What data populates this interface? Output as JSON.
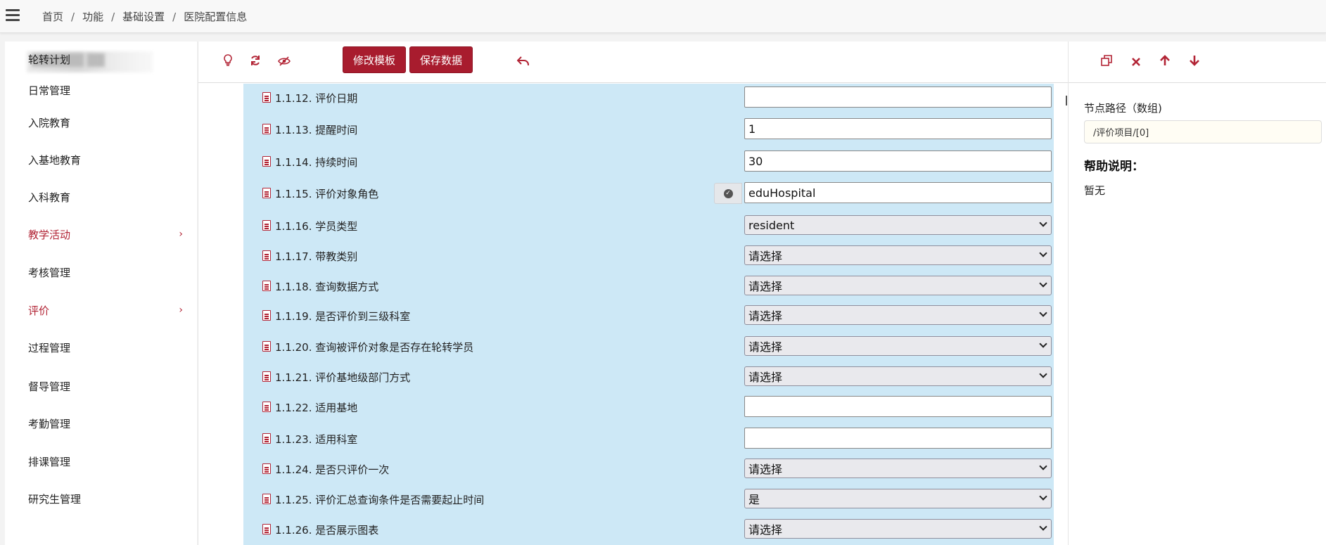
{
  "breadcrumb": [
    "首页",
    "功能",
    "基础设置",
    "医院配置信息"
  ],
  "sidebar": {
    "logo_text": "██████ ██",
    "items": [
      {
        "label": "轮转计划",
        "active": false,
        "has_sub": false
      },
      {
        "label": "日常管理",
        "active": false,
        "has_sub": false
      },
      {
        "label": "入院教育",
        "active": false,
        "has_sub": false
      },
      {
        "label": "入基地教育",
        "active": false,
        "has_sub": false
      },
      {
        "label": "入科教育",
        "active": false,
        "has_sub": false
      },
      {
        "label": "教学活动",
        "active": true,
        "has_sub": true
      },
      {
        "label": "考核管理",
        "active": false,
        "has_sub": false
      },
      {
        "label": "评价",
        "active": true,
        "has_sub": true
      },
      {
        "label": "过程管理",
        "active": false,
        "has_sub": false
      },
      {
        "label": "督导管理",
        "active": false,
        "has_sub": false
      },
      {
        "label": "考勤管理",
        "active": false,
        "has_sub": false
      },
      {
        "label": "排课管理",
        "active": false,
        "has_sub": false
      },
      {
        "label": "研究生管理",
        "active": false,
        "has_sub": false
      }
    ]
  },
  "toolbar": {
    "icons": [
      "lightbulb-icon",
      "refresh-icon",
      "eye-slash-icon",
      "undo-icon"
    ],
    "edit_template_label": "修改模板",
    "save_data_label": "保存数据"
  },
  "form": {
    "rows": [
      {
        "label": "1.1.12. 评价日期",
        "type": "input",
        "value": ""
      },
      {
        "label": "1.1.13. 提醒时间",
        "type": "input",
        "value": "1"
      },
      {
        "label": "1.1.14. 持续时间",
        "type": "input",
        "value": "30"
      },
      {
        "label": "1.1.15. 评价对象角色",
        "type": "input-check",
        "value": "eduHospital"
      },
      {
        "label": "1.1.16. 学员类型",
        "type": "select",
        "value": "resident"
      },
      {
        "label": "1.1.17. 带教类别",
        "type": "select",
        "value": "请选择"
      },
      {
        "label": "1.1.18. 查询数据方式",
        "type": "select",
        "value": "请选择"
      },
      {
        "label": "1.1.19. 是否评价到三级科室",
        "type": "select",
        "value": "请选择"
      },
      {
        "label": "1.1.20. 查询被评价对象是否存在轮转学员",
        "type": "select",
        "value": "请选择"
      },
      {
        "label": "1.1.21. 评价基地级部门方式",
        "type": "select",
        "value": "请选择"
      },
      {
        "label": "1.1.22. 适用基地",
        "type": "input",
        "value": ""
      },
      {
        "label": "1.1.23. 适用科室",
        "type": "input",
        "value": ""
      },
      {
        "label": "1.1.24. 是否只评价一次",
        "type": "select",
        "value": "请选择"
      },
      {
        "label": "1.1.25. 评价汇总查询条件是否需要起止时间",
        "type": "select",
        "value": "是"
      },
      {
        "label": "1.1.26. 是否展示图表",
        "type": "select",
        "value": "请选择"
      }
    ]
  },
  "right_panel": {
    "icons": [
      "copy-icon",
      "delete-icon",
      "arrow-up-icon",
      "arrow-down-icon"
    ],
    "path_label": "节点路径（数组)",
    "path_value": "/评价项目/[0]",
    "help_title": "帮助说明：",
    "help_body": "暂无"
  },
  "colors": {
    "accent": "#b22435",
    "form_bg": "#cde8f6",
    "button_bg": "#a81c2e"
  }
}
